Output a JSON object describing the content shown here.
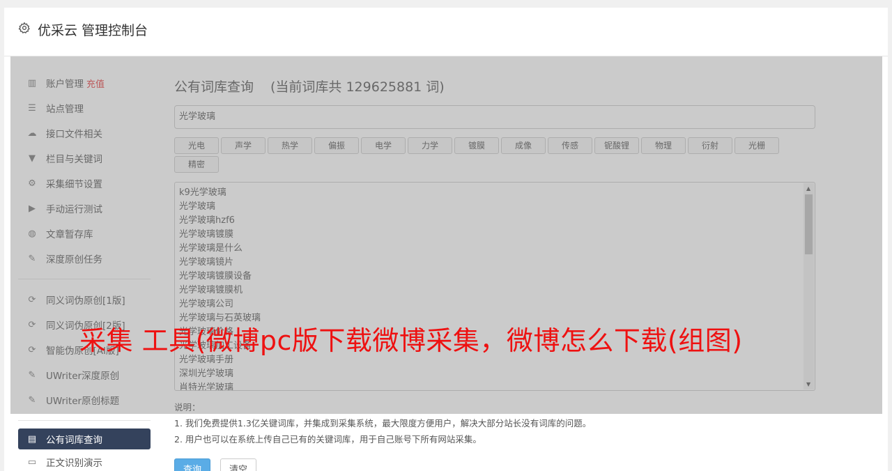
{
  "header": {
    "title": "优采云 管理控制台"
  },
  "sidebar": {
    "group1": [
      {
        "label": "账户管理",
        "badge": "充值",
        "icon": "bar-chart-icon"
      },
      {
        "label": "站点管理",
        "icon": "server-icon"
      },
      {
        "label": "接口文件相关",
        "icon": "cloud-upload-icon"
      },
      {
        "label": "栏目与关键词",
        "icon": "filter-icon"
      },
      {
        "label": "采集细节设置",
        "icon": "cogs-icon"
      },
      {
        "label": "手动运行测试",
        "icon": "play-circle-icon"
      },
      {
        "label": "文章暂存库",
        "icon": "database-icon"
      },
      {
        "label": "深度原创任务",
        "icon": "edit-icon"
      }
    ],
    "group2": [
      {
        "label": "同义词伪原创[1版]",
        "icon": "refresh-icon"
      },
      {
        "label": "同义词伪原创[2版]",
        "icon": "refresh-icon"
      },
      {
        "label": "智能伪原创[AI版]",
        "icon": "refresh-icon"
      },
      {
        "label": "UWriter深度原创",
        "icon": "edit-icon"
      },
      {
        "label": "UWriter原创标题",
        "icon": "edit-icon"
      }
    ],
    "group3": [
      {
        "label": "公有词库查询",
        "icon": "book-icon",
        "active": true
      },
      {
        "label": "正文识别演示",
        "icon": "monitor-icon"
      }
    ]
  },
  "main": {
    "title": "公有词库查询",
    "count_text": "(当前词库共 129625881 词)",
    "search_value": "光学玻璃",
    "tags": [
      "光电",
      "声学",
      "热学",
      "偏振",
      "电学",
      "力学",
      "镀膜",
      "成像",
      "传感",
      "铌酸锂",
      "物理",
      "衍射",
      "光栅",
      "精密"
    ],
    "words": [
      "k9光学玻璃",
      "光学玻璃",
      "光学玻璃hzf6",
      "光学玻璃镀膜",
      "光学玻璃是什么",
      "光学玻璃镜片",
      "光学玻璃镀膜设备",
      "光学玻璃镀膜机",
      "光学玻璃公司",
      "光学玻璃与石英玻璃",
      "光学玻璃价格",
      "光学玻璃加工设备",
      "光学玻璃手册",
      "深圳光学玻璃",
      "肖特光学玻璃"
    ],
    "notes_title": "说明：",
    "notes": [
      "1. 我们免费提供1.3亿关键词库，并集成到采集系统，最大限度方便用户，解决大部分站长没有词库的问题。",
      "2. 用户也可以在系统上传自己已有的关键词库，用于自己账号下所有网站采集。"
    ],
    "query_button": "查询",
    "clear_button": "清空"
  },
  "watermark": "采集 工具(微博pc版下载微博采集，微博怎么下载(组图)"
}
